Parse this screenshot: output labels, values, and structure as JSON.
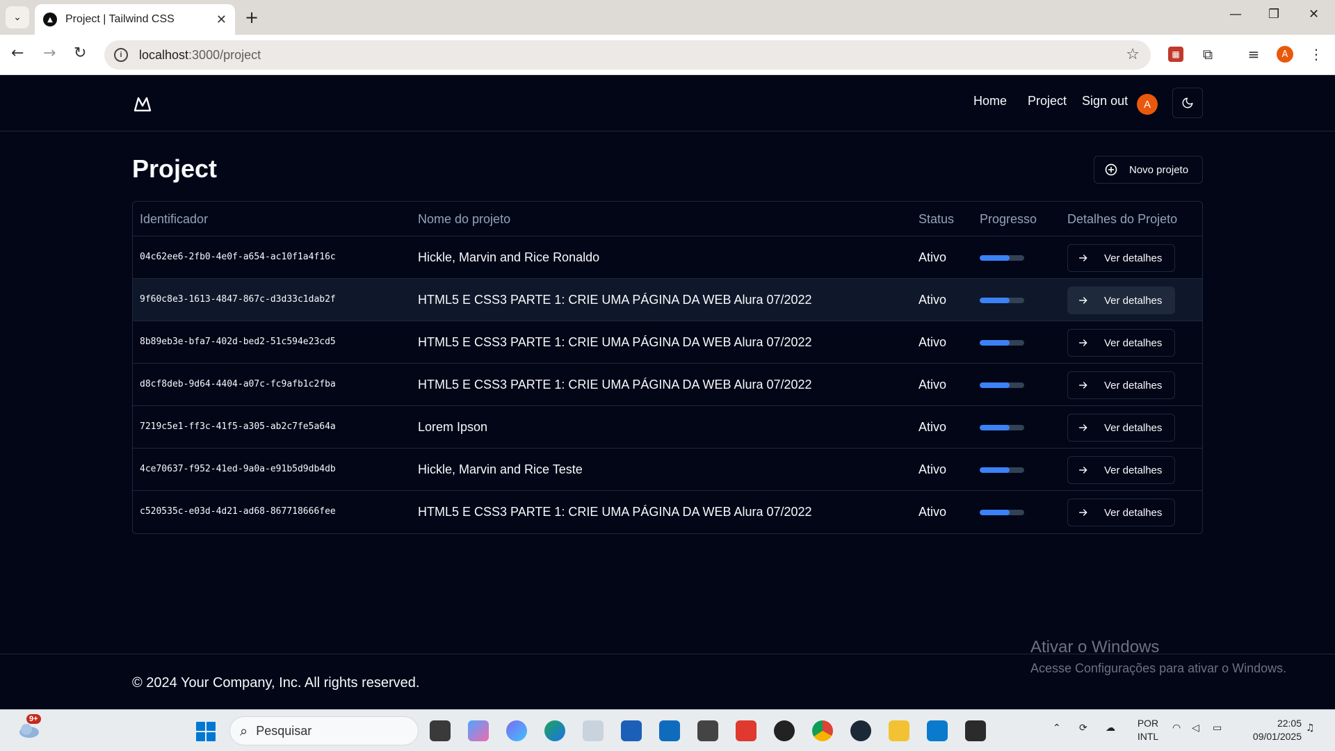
{
  "browser": {
    "tab_title": "Project | Tailwind CSS",
    "url_host": "localhost",
    "url_path": ":3000/project",
    "profile_initial": "A"
  },
  "header": {
    "nav": [
      {
        "label": "Home"
      },
      {
        "label": "Project"
      },
      {
        "label": "Sign out"
      }
    ],
    "avatar_initial": "A"
  },
  "main": {
    "title": "Project",
    "new_button_label": "Novo projeto",
    "table": {
      "columns": [
        "Identificador",
        "Nome do projeto",
        "Status",
        "Progresso",
        "Detalhes do Projeto"
      ],
      "rows": [
        {
          "id": "04c62ee6-2fb0-4e0f-a654-ac10f1a4f16c",
          "name": "Hickle, Marvin and Rice Ronaldo",
          "status": "Ativo",
          "progress": 0.67,
          "action": "Ver detalhes"
        },
        {
          "id": "9f60c8e3-1613-4847-867c-d3d33c1dab2f",
          "name": "HTML5 E CSS3 PARTE 1: CRIE UMA PÁGINA DA WEB Alura 07/2022",
          "status": "Ativo",
          "progress": 0.67,
          "action": "Ver detalhes"
        },
        {
          "id": "8b89eb3e-bfa7-402d-bed2-51c594e23cd5",
          "name": "HTML5 E CSS3 PARTE 1: CRIE UMA PÁGINA DA WEB Alura 07/2022",
          "status": "Ativo",
          "progress": 0.67,
          "action": "Ver detalhes"
        },
        {
          "id": "d8cf8deb-9d64-4404-a07c-fc9afb1c2fba",
          "name": "HTML5 E CSS3 PARTE 1: CRIE UMA PÁGINA DA WEB Alura 07/2022",
          "status": "Ativo",
          "progress": 0.67,
          "action": "Ver detalhes"
        },
        {
          "id": "7219c5e1-ff3c-41f5-a305-ab2c7fe5a64a",
          "name": "Lorem Ipson",
          "status": "Ativo",
          "progress": 0.67,
          "action": "Ver detalhes"
        },
        {
          "id": "4ce70637-f952-41ed-9a0a-e91b5d9db4db",
          "name": "Hickle, Marvin and Rice Teste",
          "status": "Ativo",
          "progress": 0.67,
          "action": "Ver detalhes"
        },
        {
          "id": "c520535c-e03d-4d21-ad68-867718666fee",
          "name": "HTML5 E CSS3 PARTE 1: CRIE UMA PÁGINA DA WEB Alura 07/2022",
          "status": "Ativo",
          "progress": 0.67,
          "action": "Ver detalhes"
        }
      ]
    }
  },
  "footer": {
    "text": "© 2024 Your Company, Inc. All rights reserved."
  },
  "watermark": {
    "line1": "Ativar o Windows",
    "line2": "Acesse Configurações para ativar o Windows."
  },
  "taskbar": {
    "search_placeholder": "Pesquisar",
    "notification_badge": "9+",
    "lang_line1": "POR",
    "lang_line2": "INTL",
    "time": "22:05",
    "date": "09/01/2025"
  },
  "colors": {
    "background": "#020617",
    "border": "#1e293b",
    "progress_fill": "#3b82f6",
    "avatar": "#ea580c"
  }
}
